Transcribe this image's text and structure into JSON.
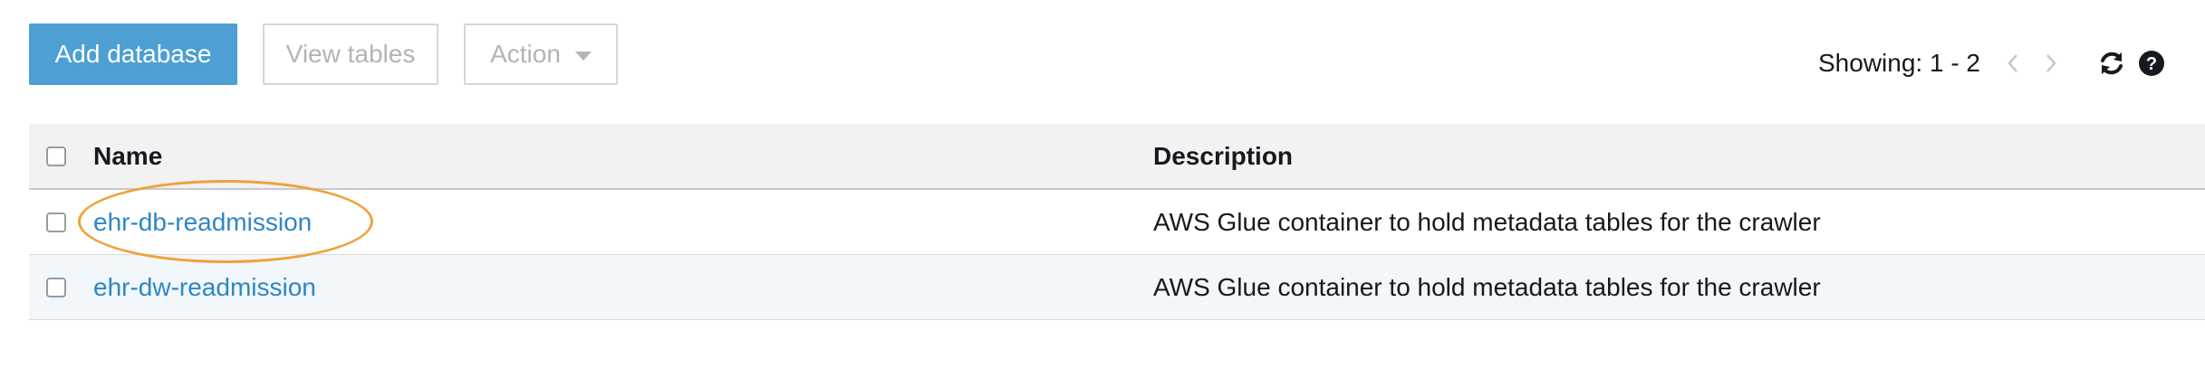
{
  "toolbar": {
    "add_database_label": "Add database",
    "view_tables_label": "View tables",
    "action_label": "Action"
  },
  "pager": {
    "showing_text": "Showing: 1 - 2"
  },
  "icons": {
    "prev": "chevron-left-icon",
    "next": "chevron-right-icon",
    "refresh": "refresh-icon",
    "help": "help-icon",
    "action_dropdown": "caret-down-icon"
  },
  "table": {
    "columns": {
      "name": "Name",
      "description": "Description"
    },
    "rows": [
      {
        "name": "ehr-db-readmission",
        "description": "AWS Glue container to hold metadata tables for the crawler",
        "highlighted": true
      },
      {
        "name": "ehr-dw-readmission",
        "description": "AWS Glue container to hold metadata tables for the crawler",
        "highlighted": false
      }
    ]
  },
  "colors": {
    "primary_button": "#4d9fd4",
    "link": "#2f86c4",
    "highlight_annotation": "#f0a13a",
    "selected_row_bg": "#f1f7fb",
    "header_bg": "#f2f2f2"
  }
}
